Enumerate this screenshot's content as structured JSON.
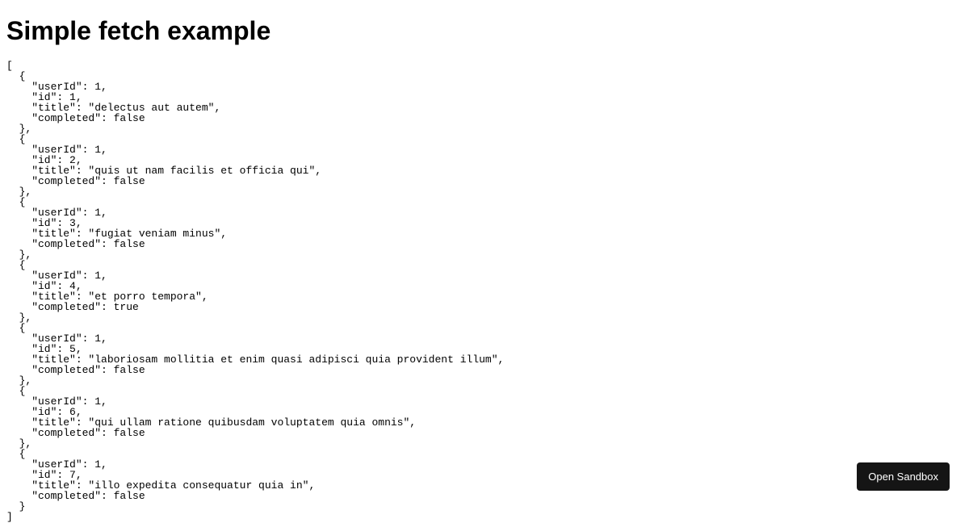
{
  "heading": "Simple fetch example",
  "button": {
    "open_sandbox": "Open Sandbox"
  },
  "response": [
    {
      "userId": 1,
      "id": 1,
      "title": "delectus aut autem",
      "completed": false
    },
    {
      "userId": 1,
      "id": 2,
      "title": "quis ut nam facilis et officia qui",
      "completed": false
    },
    {
      "userId": 1,
      "id": 3,
      "title": "fugiat veniam minus",
      "completed": false
    },
    {
      "userId": 1,
      "id": 4,
      "title": "et porro tempora",
      "completed": true
    },
    {
      "userId": 1,
      "id": 5,
      "title": "laboriosam mollitia et enim quasi adipisci quia provident illum",
      "completed": false
    },
    {
      "userId": 1,
      "id": 6,
      "title": "qui ullam ratione quibusdam voluptatem quia omnis",
      "completed": false
    },
    {
      "userId": 1,
      "id": 7,
      "title": "illo expedita consequatur quia in",
      "completed": false
    }
  ]
}
